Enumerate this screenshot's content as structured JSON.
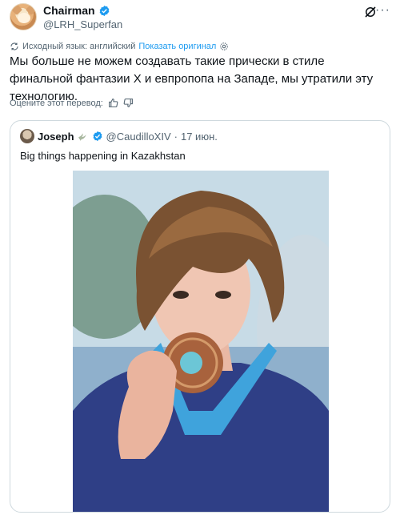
{
  "tweet": {
    "author": {
      "display_name": "Chairman",
      "handle": "@LRH_Superfan"
    },
    "translation": {
      "source_language": "Исходный язык: английский",
      "show_original": "Показать оригинал"
    },
    "text": "Мы больше не можем создавать такие прически в стиле финальной фантазии X и евпропопа на Западе, мы утратили эту технологию.",
    "rate_translation": "Оцените этот перевод:"
  },
  "quoted_tweet": {
    "display_name": "Joseph",
    "handle": "@CaudilloXIV",
    "separator": "·",
    "date": "17 июн.",
    "text": "Big things happening in Kazakhstan"
  },
  "icons": {
    "verified": "verified-badge-icon",
    "grok": "grok-icon",
    "more": "more-icon",
    "translate": "translate-icon",
    "settings": "settings-gear-icon",
    "thumbs_up": "thumbs-up-icon",
    "thumbs_down": "thumbs-down-icon",
    "dove": "dove-icon"
  },
  "colors": {
    "accent": "#1d9bf0",
    "secondary_text": "#536471",
    "border": "#cfd9de"
  }
}
